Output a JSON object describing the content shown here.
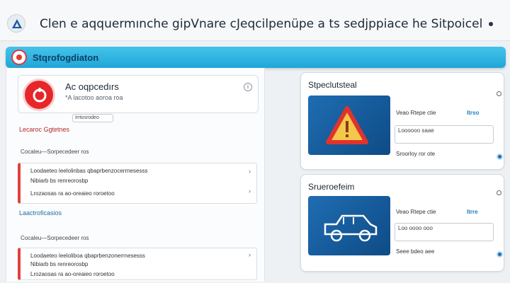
{
  "header": {
    "title": "Clen e aqquermınche gipVnare cJeqcilpenüpe a ts sedjppiace he Sitpoicel"
  },
  "section": {
    "label": "Stqrofogdiaton"
  },
  "profile": {
    "name": "Ac oqpcedırs",
    "sub": "*A lacotoo aoroa roa",
    "field": "Irrtosrodeo"
  },
  "left": {
    "heading1": "Lecaroc Ggtetnes",
    "sublabel1": "Cocaleu—Sorpecedeer ros",
    "card1": {
      "line1": "Loodaeteo leelolinbas qbaprbenzocerrnesesss",
      "line2": "Nibiarb bs renreorosbp",
      "line3": "Lrozaosas ra ao-oreaieo roroetoo"
    },
    "heading2": "Laactroficasios",
    "sublabel2": "Cocaleu—Sorpecedeer ros",
    "card2": {
      "line1": "Loodaeteo leeloliboa qbaprbenzonerrnesesss",
      "line2": "Nibiarb bs renreorosbp",
      "line3": "Lrozaosas ra ao-oreaieo roroetoo"
    }
  },
  "right": {
    "card1": {
      "title": "Stpeclutsteal",
      "info1": "Veao Rtepe ctie",
      "tag": "Itrso",
      "input1": "Loooooo saae",
      "input2": "Sroorloy ror ote"
    },
    "card2": {
      "title": "Srueroefeim",
      "info1": "Veao Rtepe ctie",
      "tag": "Itrre",
      "input1": "Loo oooo ooo",
      "input2": "Seee bdeo aee"
    }
  },
  "colors": {
    "accent_bar": "#27b1df",
    "alert_red": "#e7262a",
    "image_blue": "#1f6db2"
  },
  "icons": [
    "warning-triangle-icon",
    "alert-circle-icon",
    "car-icon",
    "menu-dot-icon"
  ]
}
